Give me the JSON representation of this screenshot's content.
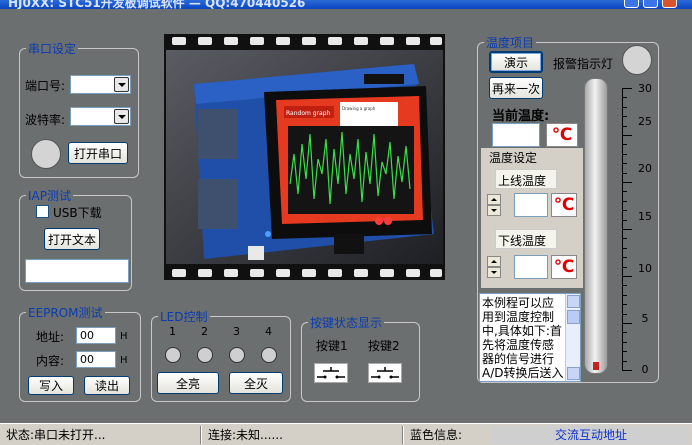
{
  "window": {
    "title": "HJ0XX: STC51开发板调试软件 — QQ:470440526"
  },
  "serial": {
    "legend": "串口设定",
    "port_label": "端口号:",
    "baud_label": "波特率:",
    "port_value": "",
    "baud_value": "",
    "open_button": "打开串口"
  },
  "iap": {
    "legend": "IAP测试",
    "usb_checkbox_label": "USB下载",
    "usb_checked": false,
    "open_text_button": "打开文本",
    "file_field_value": ""
  },
  "eeprom": {
    "legend": "EEPROM测试",
    "address_label": "地址:",
    "address_value": "00",
    "content_label": "内容:",
    "content_value": "00",
    "hex_suffix": "H",
    "write_button": "写入",
    "read_button": "读出"
  },
  "led": {
    "legend": "LED控制",
    "numbers": [
      "1",
      "2",
      "3",
      "4"
    ],
    "all_on_button": "全亮",
    "all_off_button": "全灭"
  },
  "keys": {
    "legend": "按键状态显示",
    "key1_label": "按键1",
    "key2_label": "按键2"
  },
  "temperature": {
    "legend": "温度项目",
    "demo_button": "演示",
    "again_button": "再来一次",
    "alarm_label": "报警指示灯",
    "current_label": "当前温度:",
    "current_value": "",
    "unit": "℃",
    "settings_legend": "温度设定",
    "upper_label": "上线温度",
    "upper_value": "",
    "lower_label": "下线温度",
    "lower_value": "",
    "description": "本例程可以应用到温度控制中,具体如下:首先将温度传感器的信号进行A/D转换后送入单片机,用",
    "scale_labels": [
      "30",
      "25",
      "20",
      "15",
      "10",
      "5",
      "0"
    ],
    "thermometer_level": 0
  },
  "photo": {
    "screen_title": "Random graph",
    "screen_caption": "Drawing a graph"
  },
  "status": {
    "state": "状态:串口未打开...",
    "connection": "连接:未知......",
    "blue_info": "蓝色信息:",
    "link": "交流互动地址"
  },
  "colors": {
    "background": "#6b6f6f",
    "legend_text": "#0a3cb0",
    "unit_red": "#e00000",
    "link_blue": "#0a2fd0"
  }
}
